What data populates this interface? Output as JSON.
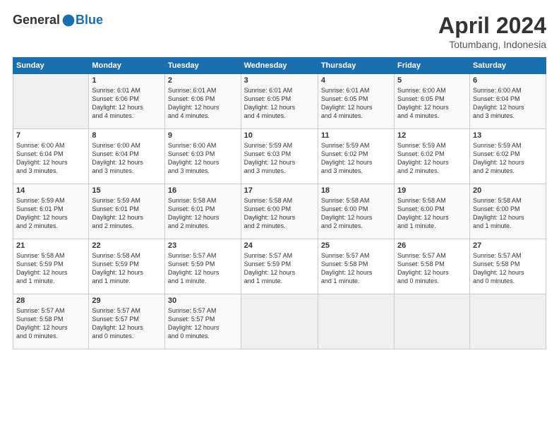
{
  "header": {
    "logo_general": "General",
    "logo_blue": "Blue",
    "month_title": "April 2024",
    "location": "Totumbang, Indonesia"
  },
  "days_of_week": [
    "Sunday",
    "Monday",
    "Tuesday",
    "Wednesday",
    "Thursday",
    "Friday",
    "Saturday"
  ],
  "weeks": [
    [
      {
        "day": "",
        "info": ""
      },
      {
        "day": "1",
        "info": "Sunrise: 6:01 AM\nSunset: 6:06 PM\nDaylight: 12 hours\nand 4 minutes."
      },
      {
        "day": "2",
        "info": "Sunrise: 6:01 AM\nSunset: 6:06 PM\nDaylight: 12 hours\nand 4 minutes."
      },
      {
        "day": "3",
        "info": "Sunrise: 6:01 AM\nSunset: 6:05 PM\nDaylight: 12 hours\nand 4 minutes."
      },
      {
        "day": "4",
        "info": "Sunrise: 6:01 AM\nSunset: 6:05 PM\nDaylight: 12 hours\nand 4 minutes."
      },
      {
        "day": "5",
        "info": "Sunrise: 6:00 AM\nSunset: 6:05 PM\nDaylight: 12 hours\nand 4 minutes."
      },
      {
        "day": "6",
        "info": "Sunrise: 6:00 AM\nSunset: 6:04 PM\nDaylight: 12 hours\nand 3 minutes."
      }
    ],
    [
      {
        "day": "7",
        "info": "Sunrise: 6:00 AM\nSunset: 6:04 PM\nDaylight: 12 hours\nand 3 minutes."
      },
      {
        "day": "8",
        "info": "Sunrise: 6:00 AM\nSunset: 6:04 PM\nDaylight: 12 hours\nand 3 minutes."
      },
      {
        "day": "9",
        "info": "Sunrise: 6:00 AM\nSunset: 6:03 PM\nDaylight: 12 hours\nand 3 minutes."
      },
      {
        "day": "10",
        "info": "Sunrise: 5:59 AM\nSunset: 6:03 PM\nDaylight: 12 hours\nand 3 minutes."
      },
      {
        "day": "11",
        "info": "Sunrise: 5:59 AM\nSunset: 6:02 PM\nDaylight: 12 hours\nand 3 minutes."
      },
      {
        "day": "12",
        "info": "Sunrise: 5:59 AM\nSunset: 6:02 PM\nDaylight: 12 hours\nand 2 minutes."
      },
      {
        "day": "13",
        "info": "Sunrise: 5:59 AM\nSunset: 6:02 PM\nDaylight: 12 hours\nand 2 minutes."
      }
    ],
    [
      {
        "day": "14",
        "info": "Sunrise: 5:59 AM\nSunset: 6:01 PM\nDaylight: 12 hours\nand 2 minutes."
      },
      {
        "day": "15",
        "info": "Sunrise: 5:59 AM\nSunset: 6:01 PM\nDaylight: 12 hours\nand 2 minutes."
      },
      {
        "day": "16",
        "info": "Sunrise: 5:58 AM\nSunset: 6:01 PM\nDaylight: 12 hours\nand 2 minutes."
      },
      {
        "day": "17",
        "info": "Sunrise: 5:58 AM\nSunset: 6:00 PM\nDaylight: 12 hours\nand 2 minutes."
      },
      {
        "day": "18",
        "info": "Sunrise: 5:58 AM\nSunset: 6:00 PM\nDaylight: 12 hours\nand 2 minutes."
      },
      {
        "day": "19",
        "info": "Sunrise: 5:58 AM\nSunset: 6:00 PM\nDaylight: 12 hours\nand 1 minute."
      },
      {
        "day": "20",
        "info": "Sunrise: 5:58 AM\nSunset: 6:00 PM\nDaylight: 12 hours\nand 1 minute."
      }
    ],
    [
      {
        "day": "21",
        "info": "Sunrise: 5:58 AM\nSunset: 5:59 PM\nDaylight: 12 hours\nand 1 minute."
      },
      {
        "day": "22",
        "info": "Sunrise: 5:58 AM\nSunset: 5:59 PM\nDaylight: 12 hours\nand 1 minute."
      },
      {
        "day": "23",
        "info": "Sunrise: 5:57 AM\nSunset: 5:59 PM\nDaylight: 12 hours\nand 1 minute."
      },
      {
        "day": "24",
        "info": "Sunrise: 5:57 AM\nSunset: 5:59 PM\nDaylight: 12 hours\nand 1 minute."
      },
      {
        "day": "25",
        "info": "Sunrise: 5:57 AM\nSunset: 5:58 PM\nDaylight: 12 hours\nand 1 minute."
      },
      {
        "day": "26",
        "info": "Sunrise: 5:57 AM\nSunset: 5:58 PM\nDaylight: 12 hours\nand 0 minutes."
      },
      {
        "day": "27",
        "info": "Sunrise: 5:57 AM\nSunset: 5:58 PM\nDaylight: 12 hours\nand 0 minutes."
      }
    ],
    [
      {
        "day": "28",
        "info": "Sunrise: 5:57 AM\nSunset: 5:58 PM\nDaylight: 12 hours\nand 0 minutes."
      },
      {
        "day": "29",
        "info": "Sunrise: 5:57 AM\nSunset: 5:57 PM\nDaylight: 12 hours\nand 0 minutes."
      },
      {
        "day": "30",
        "info": "Sunrise: 5:57 AM\nSunset: 5:57 PM\nDaylight: 12 hours\nand 0 minutes."
      },
      {
        "day": "",
        "info": ""
      },
      {
        "day": "",
        "info": ""
      },
      {
        "day": "",
        "info": ""
      },
      {
        "day": "",
        "info": ""
      }
    ]
  ]
}
